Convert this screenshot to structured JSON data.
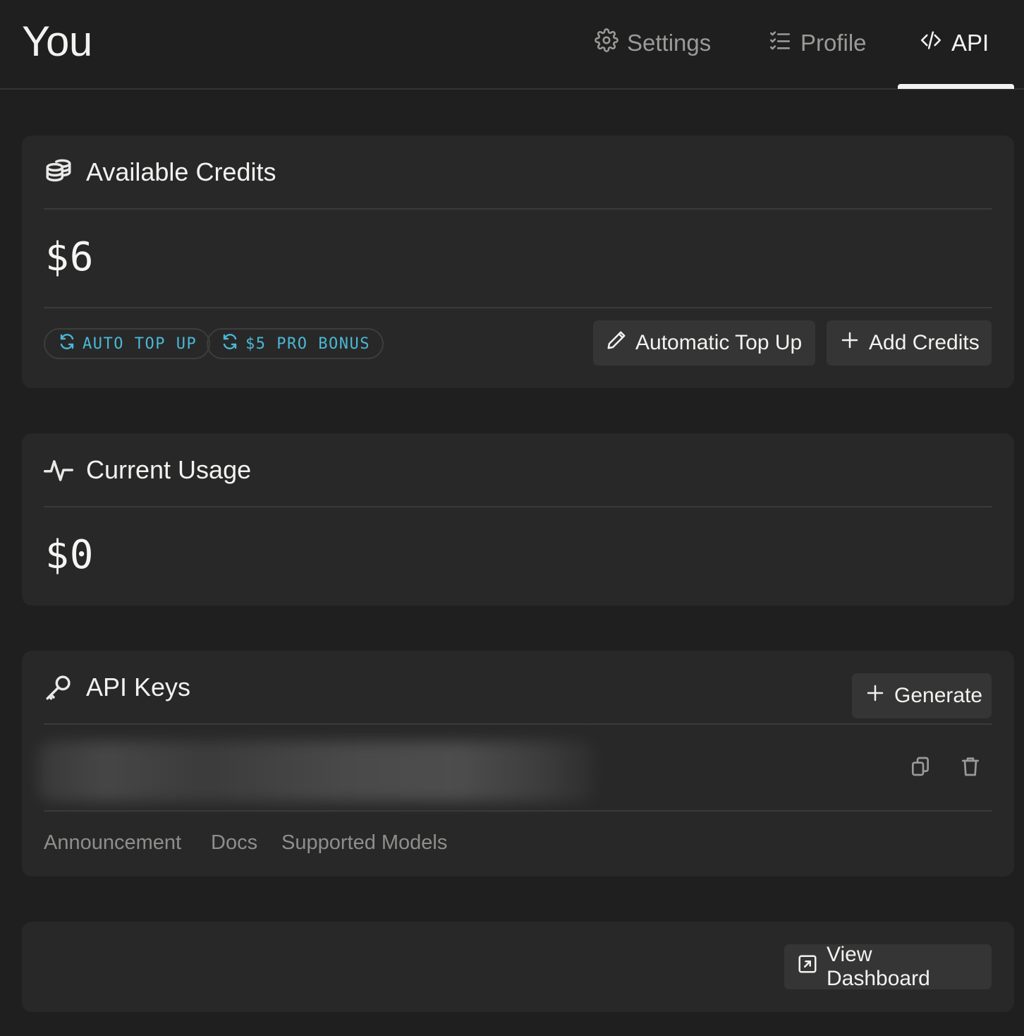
{
  "header": {
    "title": "You",
    "tabs": [
      {
        "label": "Settings",
        "icon": "gear-icon"
      },
      {
        "label": "Profile",
        "icon": "list-checks-icon"
      },
      {
        "label": "API",
        "icon": "code-icon",
        "active": true
      }
    ]
  },
  "credits": {
    "title": "Available Credits",
    "icon": "coins-icon",
    "amount": "$6",
    "badges": [
      {
        "label": "AUTO TOP UP",
        "icon": "refresh-icon"
      },
      {
        "label": "$5 PRO BONUS",
        "icon": "refresh-icon"
      }
    ],
    "auto_top_up_button": "Automatic Top Up",
    "add_credits_button": "Add Credits"
  },
  "usage": {
    "title": "Current Usage",
    "icon": "activity-icon",
    "amount": "$0"
  },
  "api_keys": {
    "title": "API Keys",
    "icon": "key-icon",
    "generate_button": "Generate",
    "keys": [
      {
        "value_visible": false,
        "actions": [
          "copy-icon",
          "trash-icon"
        ]
      }
    ],
    "links": [
      "Announcement",
      "Docs",
      "Supported Models"
    ]
  },
  "dashboard": {
    "button": "View Dashboard",
    "icon": "external-link-icon"
  },
  "colors": {
    "background": "#1f1f1f",
    "card": "#282828",
    "button": "#353535",
    "badge_accent": "#4ab8d6",
    "muted_text": "#8e8e8c"
  }
}
